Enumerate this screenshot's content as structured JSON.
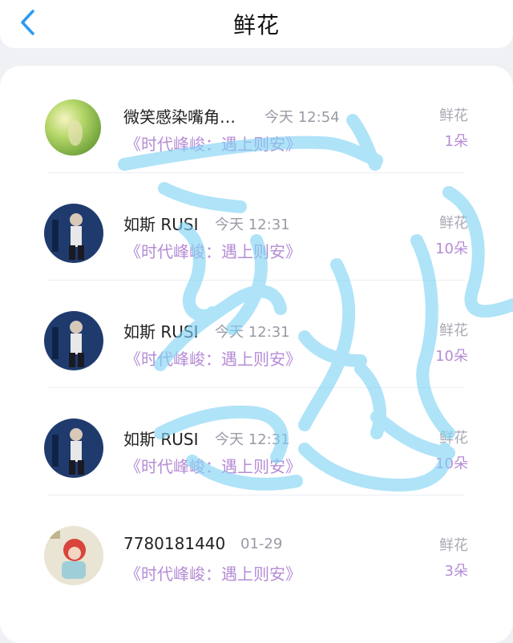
{
  "header": {
    "title": "鲜花",
    "back_icon": "chevron-left-icon",
    "accent": "#2b9af3"
  },
  "rows": [
    {
      "name": "微笑感染嘴角…",
      "time": "今天 12:54",
      "book": "《时代峰峻：遇上则安》",
      "kind": "鲜花",
      "count": "1朵",
      "avatar": "avatar-green"
    },
    {
      "name": "如斯 RUSI",
      "time": "今天 12:31",
      "book": "《时代峰峻：遇上则安》",
      "kind": "鲜花",
      "count": "10朵",
      "avatar": "avatar-blue"
    },
    {
      "name": "如斯 RUSI",
      "time": "今天 12:31",
      "book": "《时代峰峻：遇上则安》",
      "kind": "鲜花",
      "count": "10朵",
      "avatar": "avatar-blue"
    },
    {
      "name": "如斯 RUSI",
      "time": "今天 12:31",
      "book": "《时代峰峻：遇上则安》",
      "kind": "鲜花",
      "count": "10朵",
      "avatar": "avatar-blue"
    },
    {
      "name": "7780181440",
      "time": "01-29",
      "book": "《时代峰峻：遇上则安》",
      "kind": "鲜花",
      "count": "3朵",
      "avatar": "avatar-anime"
    }
  ],
  "colors": {
    "book_link": "#b58cd6",
    "scribble": "#7fd3f5"
  }
}
